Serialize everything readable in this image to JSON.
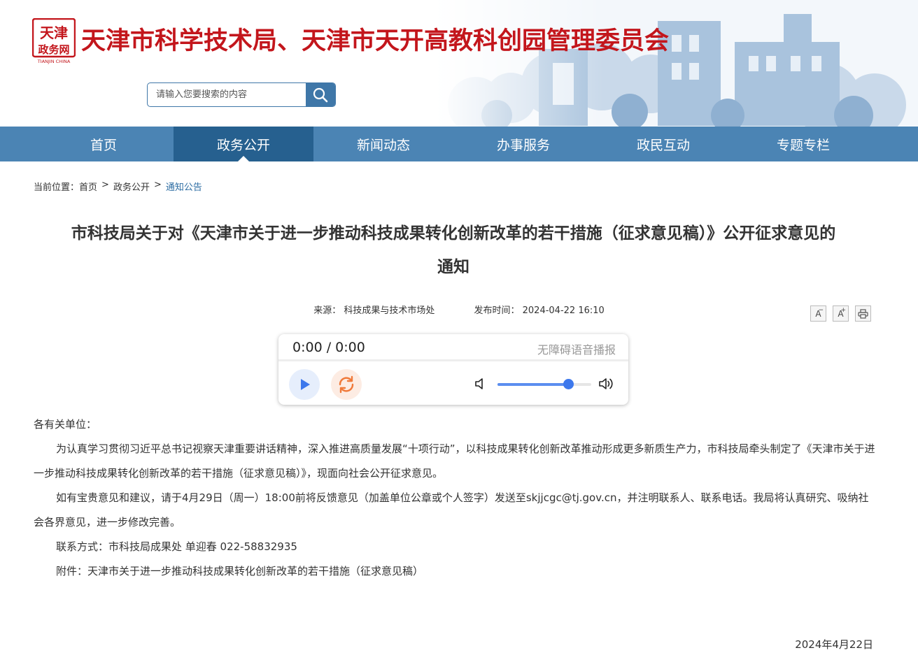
{
  "header": {
    "logo_text_top": "天津",
    "logo_text_bottom": "政务网",
    "logo_caption": "TIANJIN CHINA",
    "site_title": "天津市科学技术局、天津市天开高教科创园管理委员会"
  },
  "search": {
    "placeholder": "请输入您要搜索的内容"
  },
  "nav": {
    "items": [
      {
        "label": "首页"
      },
      {
        "label": "政务公开"
      },
      {
        "label": "新闻动态"
      },
      {
        "label": "办事服务"
      },
      {
        "label": "政民互动"
      },
      {
        "label": "专题专栏"
      }
    ],
    "active_index": 1
  },
  "breadcrumb": {
    "prefix": "当前位置：",
    "items": [
      "首页",
      "政务公开",
      "通知公告"
    ],
    "separator": ">"
  },
  "article": {
    "title": "市科技局关于对《天津市关于进一步推动科技成果转化创新改革的若干措施（征求意见稿）》公开征求意见的通知",
    "source": "来源：  科技成果与技术市场处",
    "publish_time": "发布时间：  2024-04-22 16:10",
    "tools": {
      "font_smaller": "A",
      "font_larger": "A",
      "smaller_sign": "−",
      "larger_sign": "+"
    }
  },
  "player": {
    "time": "0:00 / 0:00",
    "label": "无障碍语音播报",
    "volume_percent": 75
  },
  "content": {
    "salutation": "各有关单位：",
    "paragraphs": [
      "为认真学习贯彻习近平总书记视察天津重要讲话精神，深入推进高质量发展“十项行动”，以科技成果转化创新改革推动形成更多新质生产力，市科技局牵头制定了《天津市关于进一步推动科技成果转化创新改革的若干措施（征求意见稿）》，现面向社会公开征求意见。",
      "如有宝贵意见和建议，请于4月29日（周一）18:00前将反馈意见（加盖单位公章或个人签字）发送至skjjcgc@tj.gov.cn，并注明联系人、联系电话。我局将认真研究、吸纳社会各界意见，进一步修改完善。",
      "联系方式：市科技局成果处 单迎春 022-58832935",
      "附件：天津市关于进一步推动科技成果转化创新改革的若干措施（征求意见稿）"
    ],
    "date": "2024年4月22日"
  },
  "colors": {
    "brand_red": "#c3161c",
    "nav_blue": "#4b84b4",
    "nav_active": "#26608f",
    "link_blue": "#2d6da3"
  }
}
